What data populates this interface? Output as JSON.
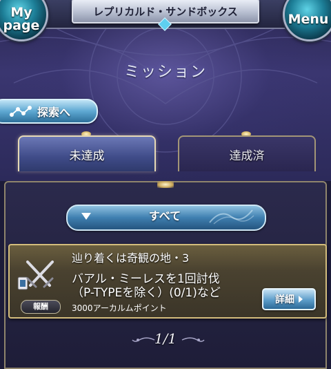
{
  "header": {
    "mypage_label": "My page",
    "mypage_line1": "My",
    "mypage_line2": "page",
    "menu_label": "Menu",
    "title": "レプリカルド・サンドボックス"
  },
  "page": {
    "heading": "ミッション"
  },
  "explore_button": {
    "label": "探索へ",
    "icon": "route-nodes-icon"
  },
  "tabs": [
    {
      "label": "未達成",
      "active": true
    },
    {
      "label": "達成済",
      "active": false
    }
  ],
  "filter": {
    "selected": "すべて"
  },
  "missions": [
    {
      "title": "辿り着くは奇観の地・3",
      "description_line1": "バアル・ミーレスを1回討伐",
      "description_line2": "（P-TYPEを除く）(0/1)など",
      "reward_badge": "報酬",
      "reward": "3000アーカルムポイント",
      "detail_label": "詳細",
      "icon": "crossed-swords-icon"
    }
  ],
  "pagination": {
    "text": "1/1"
  },
  "colors": {
    "accent_blue": "#5ea8d2",
    "gold_border": "#d4bd7d",
    "panel_bg": "#1e1d38"
  }
}
